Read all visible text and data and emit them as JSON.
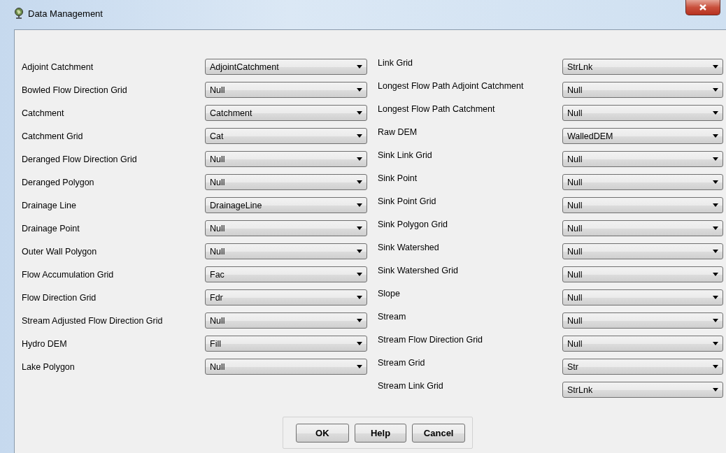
{
  "window": {
    "title": "Data Management"
  },
  "left_fields": [
    {
      "label": "Adjoint Catchment",
      "value": "AdjointCatchment"
    },
    {
      "label": "Bowled Flow Direction Grid",
      "value": "Null"
    },
    {
      "label": "Catchment",
      "value": "Catchment"
    },
    {
      "label": "Catchment Grid",
      "value": "Cat"
    },
    {
      "label": "Deranged Flow Direction Grid",
      "value": "Null"
    },
    {
      "label": "Deranged Polygon",
      "value": "Null"
    },
    {
      "label": "Drainage Line",
      "value": "DrainageLine"
    },
    {
      "label": "Drainage Point",
      "value": "Null"
    },
    {
      "label": "Outer Wall Polygon",
      "value": "Null"
    },
    {
      "label": "Flow Accumulation Grid",
      "value": "Fac"
    },
    {
      "label": "Flow Direction Grid",
      "value": "Fdr"
    },
    {
      "label": "Stream Adjusted Flow Direction Grid",
      "value": "Null"
    },
    {
      "label": "Hydro DEM",
      "value": "Fill"
    },
    {
      "label": "Lake Polygon",
      "value": "Null"
    }
  ],
  "right_fields": [
    {
      "label": "Link Grid",
      "value": "StrLnk"
    },
    {
      "label": "Longest Flow Path Adjoint Catchment",
      "value": "Null"
    },
    {
      "label": "Longest Flow Path Catchment",
      "value": "Null"
    },
    {
      "label": "Raw DEM",
      "value": "WalledDEM"
    },
    {
      "label": "Sink Link Grid",
      "value": "Null"
    },
    {
      "label": "Sink Point",
      "value": "Null"
    },
    {
      "label": "Sink Point Grid",
      "value": "Null"
    },
    {
      "label": "Sink Polygon Grid",
      "value": "Null"
    },
    {
      "label": "Sink Watershed",
      "value": "Null"
    },
    {
      "label": "Sink Watershed Grid",
      "value": "Null"
    },
    {
      "label": "Slope",
      "value": "Null"
    },
    {
      "label": "Stream",
      "value": "Null"
    },
    {
      "label": "Stream Flow Direction Grid",
      "value": "Null"
    },
    {
      "label": "Stream Grid",
      "value": "Str"
    },
    {
      "label": "Stream Link Grid",
      "value": "StrLnk"
    }
  ],
  "buttons": [
    "OK",
    "Help",
    "Cancel"
  ]
}
